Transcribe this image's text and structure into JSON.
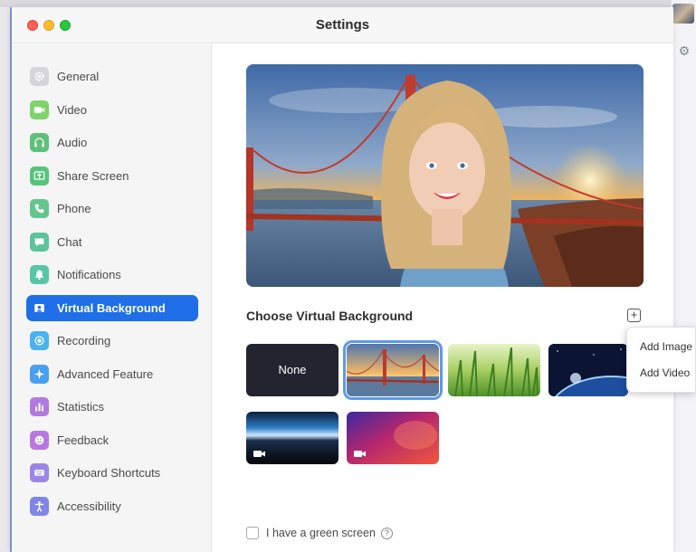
{
  "window": {
    "title": "Settings"
  },
  "sidebar": {
    "items": [
      {
        "label": "General",
        "icon": "gear-icon",
        "color": "#d6d6d9",
        "active": false
      },
      {
        "label": "Video",
        "icon": "video-camera-icon",
        "color": "#7fd36a",
        "active": false
      },
      {
        "label": "Audio",
        "icon": "headphones-icon",
        "color": "#5fc07c",
        "active": false
      },
      {
        "label": "Share Screen",
        "icon": "share-screen-icon",
        "color": "#58c47b",
        "active": false
      },
      {
        "label": "Phone",
        "icon": "phone-icon",
        "color": "#62c58c",
        "active": false
      },
      {
        "label": "Chat",
        "icon": "chat-bubble-icon",
        "color": "#5cc39a",
        "active": false
      },
      {
        "label": "Notifications",
        "icon": "bell-icon",
        "color": "#58c6a2",
        "active": false
      },
      {
        "label": "Virtual Background",
        "icon": "person-portrait-icon",
        "color": "#ffffff",
        "active": true
      },
      {
        "label": "Recording",
        "icon": "record-icon",
        "color": "#4ab2f0",
        "active": false
      },
      {
        "label": "Advanced Feature",
        "icon": "sparkle-icon",
        "color": "#4aa0ee",
        "active": false
      },
      {
        "label": "Statistics",
        "icon": "bar-chart-icon",
        "color": "#b07ae0",
        "active": false
      },
      {
        "label": "Feedback",
        "icon": "smiley-icon",
        "color": "#b878e0",
        "active": false
      },
      {
        "label": "Keyboard Shortcuts",
        "icon": "keyboard-icon",
        "color": "#9b86e6",
        "active": false
      },
      {
        "label": "Accessibility",
        "icon": "accessibility-person-icon",
        "color": "#7f86e6",
        "active": false
      }
    ]
  },
  "main": {
    "section_title": "Choose Virtual Background",
    "backgrounds": [
      {
        "label": "None",
        "kind": "none",
        "selected": false
      },
      {
        "label": "",
        "kind": "golden-gate-bridge",
        "selected": true
      },
      {
        "label": "",
        "kind": "grass",
        "selected": false
      },
      {
        "label": "",
        "kind": "earth-from-space",
        "selected": false
      },
      {
        "label": "",
        "kind": "earth-horizon-video",
        "selected": false
      },
      {
        "label": "",
        "kind": "aurora-gradient-video",
        "selected": false
      }
    ],
    "green_screen_label": "I have a green screen",
    "green_screen_checked": false
  },
  "add_menu": {
    "items": [
      "Add Image",
      "Add Video"
    ]
  },
  "colors": {
    "accent": "#1e6fe8",
    "selected_outline": "#5b9ae8"
  }
}
